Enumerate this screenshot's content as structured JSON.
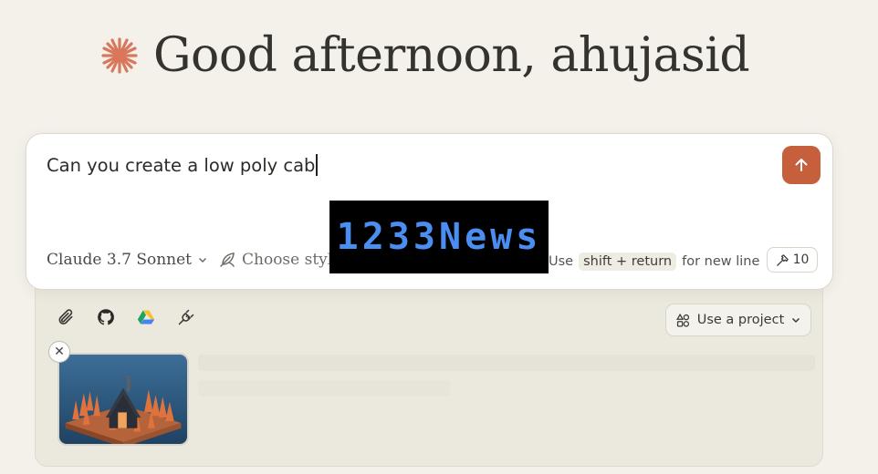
{
  "greeting": {
    "text": "Good afternoon, ahujasid",
    "logo_icon": "anthropic-spark-icon",
    "logo_color": "#d9775a"
  },
  "composer": {
    "input_value": "Can you create a low poly cab",
    "send_icon": "arrow-up-icon",
    "send_color": "#c65f3c",
    "model_label": "Claude 3.7 Sonnet",
    "style_label": "Choose style",
    "hint": {
      "prefix": "Use",
      "key": "shift + return",
      "suffix": "for new line"
    },
    "tools_count": "10"
  },
  "tray": {
    "icons": [
      "paperclip-icon",
      "github-icon",
      "google-drive-icon",
      "plug-icon"
    ],
    "project_label": "Use a project"
  },
  "watermark": {
    "text": "1233News",
    "color": "#4a8ef2"
  }
}
